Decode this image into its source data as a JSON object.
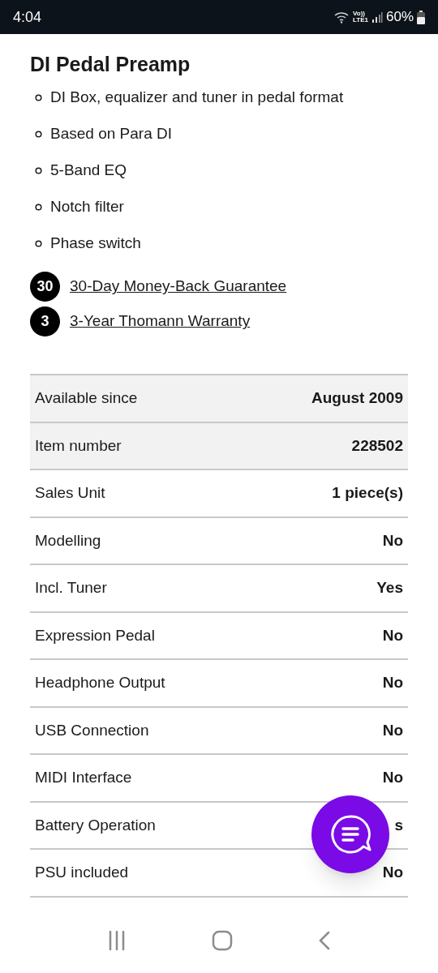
{
  "status_bar": {
    "time": "4:04",
    "volte": "Vo))",
    "network": "LTE1",
    "battery": "60%"
  },
  "title": "DI Pedal Preamp",
  "features": [
    "DI Box, equalizer and tuner in pedal format",
    "Based on Para DI",
    "5-Band EQ",
    "Notch filter",
    "Phase switch"
  ],
  "guarantees": [
    {
      "badge": "30",
      "label": "30-Day Money-Back Guarantee"
    },
    {
      "badge": "3",
      "label": "3-Year Thomann Warranty"
    }
  ],
  "specs": [
    {
      "label": "Available since",
      "value": "August 2009",
      "highlighted": true
    },
    {
      "label": "Item number",
      "value": "228502",
      "highlighted": true
    },
    {
      "label": "Sales Unit",
      "value": "1 piece(s)",
      "highlighted": false
    },
    {
      "label": "Modelling",
      "value": "No",
      "highlighted": false
    },
    {
      "label": "Incl. Tuner",
      "value": "Yes",
      "highlighted": false
    },
    {
      "label": "Expression Pedal",
      "value": "No",
      "highlighted": false
    },
    {
      "label": "Headphone Output",
      "value": "No",
      "highlighted": false
    },
    {
      "label": "USB Connection",
      "value": "No",
      "highlighted": false
    },
    {
      "label": "MIDI Interface",
      "value": "No",
      "highlighted": false
    },
    {
      "label": "Battery Operation",
      "value": "s",
      "highlighted": false
    },
    {
      "label": "PSU included",
      "value": "No",
      "highlighted": false
    }
  ]
}
